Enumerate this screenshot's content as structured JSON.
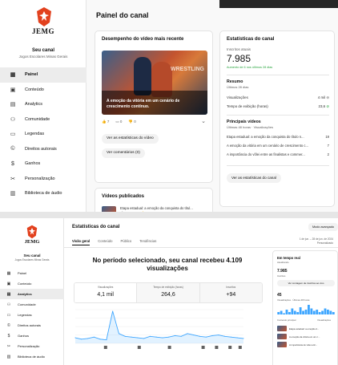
{
  "top": {
    "brand": "JEMG",
    "channel_name": "Seu canal",
    "channel_sub": "Jogos Escolares Minas Gerais",
    "page_title": "Painel do canal",
    "nav": [
      {
        "label": "Painel",
        "icon": "dashboard-icon",
        "active": true
      },
      {
        "label": "Conteúdo",
        "icon": "content-icon"
      },
      {
        "label": "Analytics",
        "icon": "analytics-icon"
      },
      {
        "label": "Comunidade",
        "icon": "community-icon"
      },
      {
        "label": "Legendas",
        "icon": "subtitles-icon"
      },
      {
        "label": "Direitos autorais",
        "icon": "copyright-icon"
      },
      {
        "label": "Ganhos",
        "icon": "earn-icon"
      },
      {
        "label": "Personalização",
        "icon": "customization-icon"
      },
      {
        "label": "Biblioteca de áudio",
        "icon": "audio-library-icon"
      }
    ],
    "latest_video": {
      "heading": "Desempenho do vídeo mais recente",
      "caption": "A emoção da vitória em um cenário de crescimento contínuo.",
      "banner": "WRESTLING",
      "likes": "7",
      "comments": "0",
      "dislikes": "0",
      "btn_stats": "Ver as estatísticas do vídeo",
      "btn_comments": "Ver comentários (0)"
    },
    "published": {
      "heading": "Vídeos publicados",
      "item_title": "Etapa estadual: a emoção da conquista do títul...",
      "item_views": "34",
      "item_comments": "1",
      "item_likes": "0"
    },
    "stats": {
      "heading": "Estatísticas do canal",
      "subs_label": "Inscritos atuais",
      "subs_value": "7.985",
      "subs_delta": "Aumento de 6 nos últimos 28 dias",
      "summary_heading": "Resumo",
      "summary_sub": "Últimos 28 dias",
      "views_label": "Visualizações",
      "views_value": "4 mil",
      "watch_label": "Tempo de exibição (horas)",
      "watch_value": "23,6",
      "top_heading": "Principais vídeos",
      "top_sub": "Últimas 48 horas · Visualizações",
      "top_videos": [
        {
          "title": "Etapa estadual: a emoção da conquista do título n...",
          "views": "19"
        },
        {
          "title": "A emoção da vitória em um cenário de crescimento c...",
          "views": "7"
        },
        {
          "title": "A importância do vôlei entre as finalistas e commer...",
          "views": "2"
        }
      ],
      "btn": "Ver as estatísticas do canal"
    }
  },
  "bottom": {
    "brand": "JEMG",
    "channel_name": "Seu canal",
    "channel_sub": "Jogos Escolares Minas Gerais",
    "page_title": "Estatísticas do canal",
    "mode_button": "Modo avançado",
    "date_range_1": "1 de jun. – 28 de jun. de 2024",
    "date_range_2": "Personalizado",
    "tabs": [
      "Visão geral",
      "Conteúdo",
      "Público",
      "Tendências"
    ],
    "headline": "No período selecionado, seu canal recebeu 4.109 visualizações",
    "metrics": [
      {
        "label": "Visualizações",
        "value": "4,1 mil"
      },
      {
        "label": "Tempo de exibição (horas)",
        "value": "264,6"
      },
      {
        "label": "Inscritos",
        "value": "+94"
      }
    ],
    "nav": [
      {
        "label": "Painel",
        "icon": "dashboard-icon"
      },
      {
        "label": "Conteúdo",
        "icon": "content-icon"
      },
      {
        "label": "Analytics",
        "icon": "analytics-icon",
        "active": true
      },
      {
        "label": "Comunidade",
        "icon": "community-icon"
      },
      {
        "label": "Legendas",
        "icon": "subtitles-icon"
      },
      {
        "label": "Direitos autorais",
        "icon": "copyright-icon"
      },
      {
        "label": "Ganhos",
        "icon": "earn-icon"
      },
      {
        "label": "Personalização",
        "icon": "customization-icon"
      },
      {
        "label": "Biblioteca de áudio",
        "icon": "audio-library-icon"
      }
    ],
    "right": {
      "heading": "Em tempo real",
      "sub": "Atualizando",
      "subs": "7.985",
      "subs_label": "Inscritos",
      "btn": "Ver contagem de inscritos ao vivo",
      "views": "45",
      "views_label": "Visualizações · Últimas 48 horas",
      "top_label": "Conteúdo principal",
      "top_right": "Visualizações",
      "items": [
        "Etapa estadual: a emoção d...",
        "A emoção da vitória em um c...",
        "A importância do vôlei entr..."
      ]
    },
    "chart_data": {
      "type": "line",
      "y": [
        8,
        6,
        7,
        9,
        6,
        5,
        46,
        14,
        10,
        9,
        8,
        7,
        10,
        9,
        8,
        9,
        11,
        10,
        14,
        12,
        10,
        9,
        11,
        12,
        10,
        9,
        8,
        7
      ]
    }
  },
  "colors": {
    "brand_red": "#e2411e",
    "accent_green": "#2ba640",
    "chart_blue": "#3ea6ff"
  }
}
